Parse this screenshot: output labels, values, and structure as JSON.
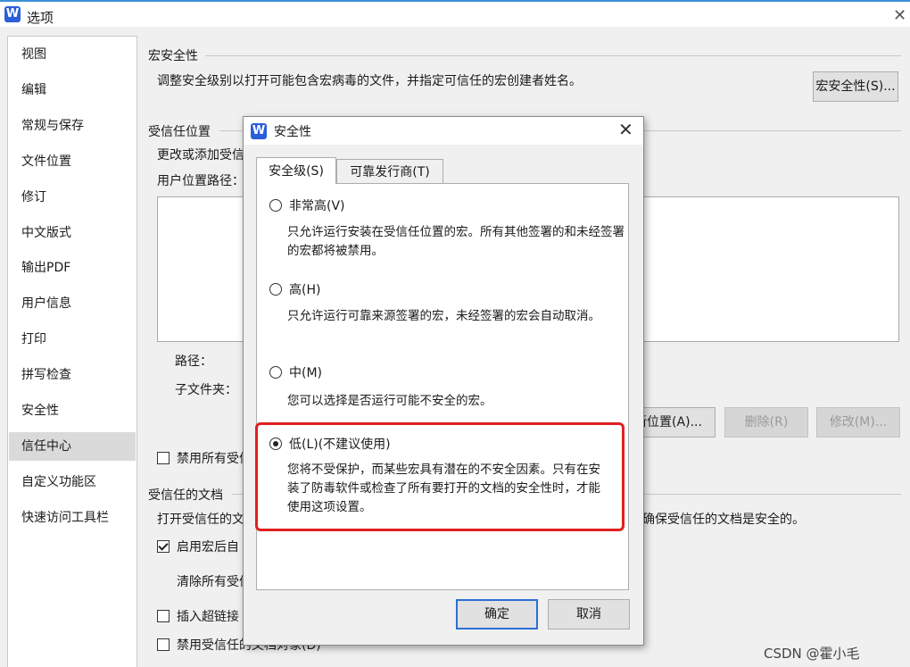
{
  "window": {
    "app_icon": "wps-logo",
    "app_icon_letter": "W",
    "title": "选项",
    "close": "✕"
  },
  "sidebar": {
    "items": [
      "视图",
      "编辑",
      "常规与保存",
      "文件位置",
      "修订",
      "中文版式",
      "输出PDF",
      "用户信息",
      "打印",
      "拼写检查",
      "安全性",
      "信任中心",
      "自定义功能区",
      "快速访问工具栏"
    ],
    "selected_index": 11
  },
  "macro": {
    "title": "宏安全性",
    "desc": "调整安全级别以打开可能包含宏病毒的文件，并指定可信任的宏创建者姓名。",
    "button": "宏安全性(S)..."
  },
  "trusted_locations": {
    "title": "受信任位置",
    "desc": "更改或添加受信",
    "path_label": "用户位置路径：",
    "path_field": "路径：",
    "subfolder_field": "子文件夹：",
    "buttons": {
      "add": "新位置(A)...",
      "delete": "删除(R)",
      "modify": "修改(M)..."
    }
  },
  "disable_all_check": {
    "label": "禁用所有受信",
    "checked": false
  },
  "trusted_docs": {
    "title": "受信任的文档",
    "desc_start": "打开受信任的文",
    "desc_end": "确保受信任的文档是安全的。",
    "enable_macro": {
      "label": "启用宏后自",
      "checked": true
    },
    "clear_all": "清除所有受信",
    "hyperlink": {
      "label": "插入超链接",
      "checked": false
    },
    "disable_docs": {
      "label": "禁用受信任的文档对象(D)",
      "checked": false
    }
  },
  "dialog": {
    "icon": "wps-logo",
    "icon_letter": "W",
    "title": "安全性",
    "close": "✕",
    "tabs": [
      {
        "label": "安全级(S)",
        "active": true
      },
      {
        "label": "可靠发行商(T)",
        "active": false
      }
    ],
    "options": [
      {
        "label": "非常高(V)",
        "desc": "只允许运行安装在受信任位置的宏。所有其他签署的和未经签署的宏都将被禁用。",
        "selected": false
      },
      {
        "label": "高(H)",
        "desc": "只允许运行可靠来源签署的宏，未经签署的宏会自动取消。",
        "selected": false
      },
      {
        "label": "中(M)",
        "desc": "您可以选择是否运行可能不安全的宏。",
        "selected": false
      },
      {
        "label": "低(L)(不建议使用)",
        "desc": "您将不受保护，而某些宏具有潜在的不安全因素。只有在安装了防毒软件或检查了所有要打开的文档的安全性时，才能使用这项设置。",
        "selected": true
      }
    ],
    "highlight_color": "#e02020",
    "ok": "确定",
    "cancel": "取消"
  },
  "watermark": "CSDN @霍小毛",
  "colors": {
    "accent": "#2b5fd9",
    "selected_sidebar": "#dadada"
  }
}
